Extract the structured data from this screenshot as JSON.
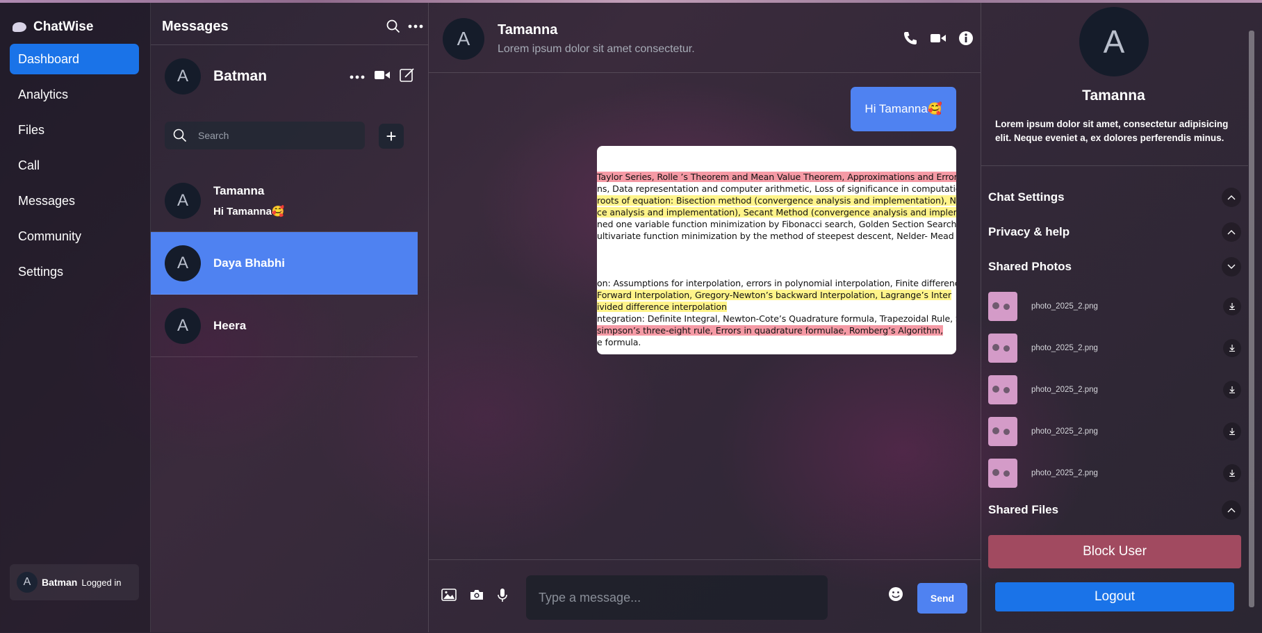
{
  "app": {
    "name": "ChatWise"
  },
  "nav": {
    "items": [
      {
        "label": "Dashboard",
        "active": true
      },
      {
        "label": "Analytics"
      },
      {
        "label": "Files"
      },
      {
        "label": "Call"
      },
      {
        "label": "Messages"
      },
      {
        "label": "Community"
      },
      {
        "label": "Settings"
      }
    ],
    "user": {
      "initial": "A",
      "name": "Batman",
      "status": "Logged in"
    }
  },
  "messages": {
    "title": "Messages",
    "me": {
      "initial": "A",
      "name": "Batman"
    },
    "search_placeholder": "Search",
    "contacts": [
      {
        "initial": "A",
        "name": "Tamanna",
        "last": "Hi Tamanna🥰"
      },
      {
        "initial": "A",
        "name": "Daya Bhabhi",
        "last": "",
        "active": true
      },
      {
        "initial": "A",
        "name": "Heera",
        "last": ""
      }
    ]
  },
  "chat": {
    "contact_initial": "A",
    "contact_name": "Tamanna",
    "contact_status": "Lorem ipsum dolor sit amet consectetur.",
    "bubble_text": "Hi Tamanna🥰",
    "doc_lines": [
      "Taylor Series, Rolle ’s Theorem and Mean Value Theorem, Approximations and Errors in n",
      "ns, Data representation and computer arithmetic, Loss of significance in computation",
      " roots of equation: Bisection method (convergence analysis and implementation), Newton",
      "ce analysis and implementation), Secant Method (convergence analysis and impleme",
      "ned one variable function minimization by Fibonacci search, Golden Section Search and",
      "ultivariate function minimization by the method of steepest descent, Nelder- Mead Algorith",
      "on: Assumptions for interpolation, errors in polynomial interpolation, Finite differences,",
      "Forward Interpolation, Gregory-Newton’s backward Interpolation, Lagrange’s Inter",
      "ivided difference interpolation",
      "ntegration: Definite Integral, Newton-Cote’s Quadrature formula, Trapezoidal Rule, Simpso",
      " simpson’s three-eight rule, Errors in quadrature formulae, Romberg’s Algorithm,",
      "e formula."
    ],
    "input_placeholder": "Type a message...",
    "send_label": "Send"
  },
  "profile": {
    "initial": "A",
    "name": "Tamanna",
    "bio": "Lorem ipsum dolor sit amet, consectetur adipisicing elit. Neque eveniet a, ex dolores perferendis minus.",
    "sections": {
      "chat_settings": "Chat Settings",
      "privacy": "Privacy & help",
      "shared_photos": "Shared Photos",
      "shared_files": "Shared Files"
    },
    "photos": [
      "photo_2025_2.png",
      "photo_2025_2.png",
      "photo_2025_2.png",
      "photo_2025_2.png",
      "photo_2025_2.png"
    ],
    "block_label": "Block User",
    "logout_label": "Logout"
  },
  "colors": {
    "accent": "#1a73e8",
    "selected": "#4f82f1",
    "danger": "#a14a60"
  },
  "icons": [
    "search-icon",
    "more-icon",
    "video-icon",
    "edit-icon",
    "plus-icon",
    "phone-icon",
    "info-icon",
    "image-icon",
    "camera-icon",
    "mic-icon",
    "emoji-icon",
    "chevron-up-icon",
    "chevron-down-icon",
    "download-icon",
    "chat-bubble-icon"
  ]
}
